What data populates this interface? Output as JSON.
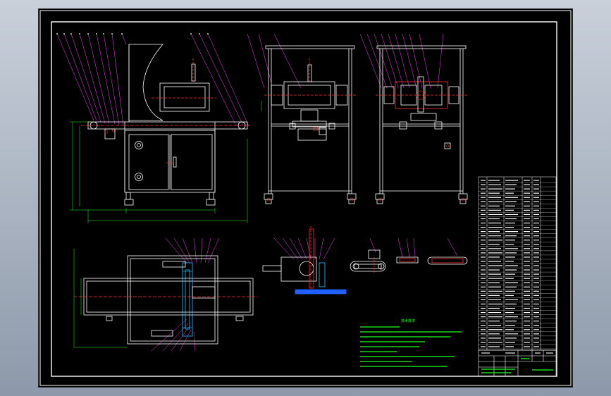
{
  "viewer": {
    "background_top": "#c9d0da",
    "background_bottom": "#8d99aa"
  },
  "drawing": {
    "paper_color": "#000000",
    "line_color": "#ffffff",
    "dimension_color": "#20ff20",
    "center_line_color": "#ff3030",
    "hatch_color": "#30c0ff",
    "leader_color": "#ff40ff",
    "notes": {
      "title": "技术要求"
    }
  }
}
